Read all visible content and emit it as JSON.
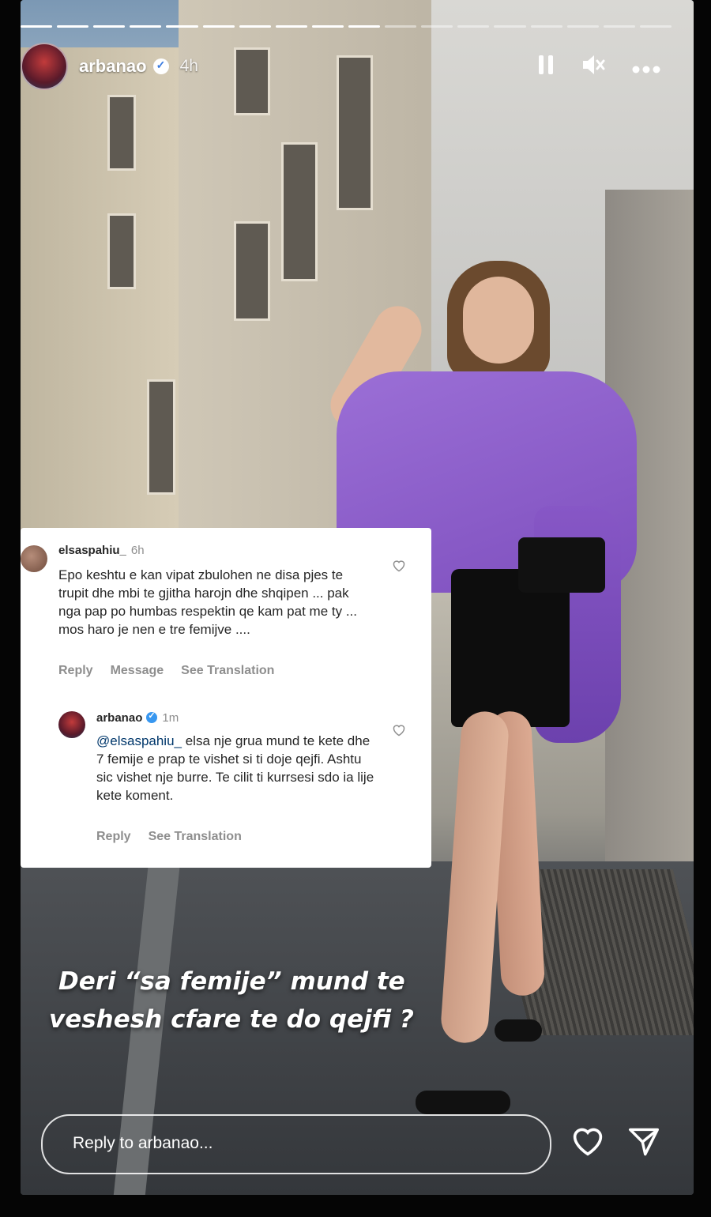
{
  "story": {
    "username": "arbanao",
    "time": "4h",
    "progress_segments": [
      1,
      1,
      1,
      1,
      1,
      1,
      1,
      1,
      1,
      1,
      0,
      0,
      0,
      0,
      0,
      0,
      0,
      0
    ]
  },
  "header_icons": {
    "pause": "pause-icon",
    "mute": "muted-speaker-icon",
    "more": "more-options-icon"
  },
  "comment": {
    "username": "elsaspahiu_",
    "time": "6h",
    "text": "Epo keshtu e kan vipat zbulohen ne disa pjes te trupit dhe mbi te gjitha harojn dhe shqipen ... pak nga pap po humbas respektin qe kam pat me ty ... mos haro je nen e tre femijve ....",
    "actions": {
      "reply": "Reply",
      "message": "Message",
      "translate": "See Translation"
    }
  },
  "reply": {
    "username": "arbanao",
    "time": "1m",
    "mention": "@elsaspahiu_",
    "text": " elsa nje grua mund te kete dhe 7 femije e prap te vishet si ti doje qejfi. Ashtu sic vishet nje burre. Te cilit ti kurrsesi sdo ia lije kete koment.",
    "actions": {
      "reply": "Reply",
      "translate": "See Translation"
    }
  },
  "caption": {
    "line1": "Deri “sa femije” mund te",
    "line2": "veshesh cfare te do qejfi ?"
  },
  "reply_bar": {
    "placeholder": "Reply to arbanao..."
  },
  "colors": {
    "shirt": "#8a5bc9",
    "verified": "#3897f0",
    "mention": "#00376b"
  }
}
